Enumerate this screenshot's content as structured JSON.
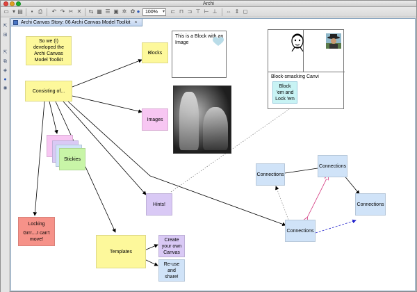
{
  "app": {
    "title": "Archi"
  },
  "toolbar": {
    "zoom": "100%"
  },
  "editor": {
    "tab_label": "Archi Canvas Story: 06 Archi Canvas Model Toolkit"
  },
  "canvas": {
    "intro": "So we (I) developed the Archi Canvas Model Toolkit",
    "consisting": "Consisting of...",
    "blocks": "Blocks",
    "images": "Images",
    "stickies": "Stickies",
    "hints": "Hints!",
    "locking_title": "Locking",
    "locking_text": "Grrr....I can't move!",
    "templates": "Templates",
    "create": "Create your own Canvas",
    "reuse": "Re-use and share!",
    "block_image_text": "This is a Block with an Image",
    "block_canvas_text": "Block-smacking Canvi",
    "block_lock_text": "Block 'em and Lock 'em",
    "connections": "Connections"
  },
  "colors": {
    "yellow": "#fdf89b",
    "pink": "#f7c6f2",
    "lilac": "#d9c9f5",
    "blue": "#d0e3f8",
    "red": "#f69289",
    "green": "#c8f5a7",
    "cyan": "#c8f3f4"
  }
}
